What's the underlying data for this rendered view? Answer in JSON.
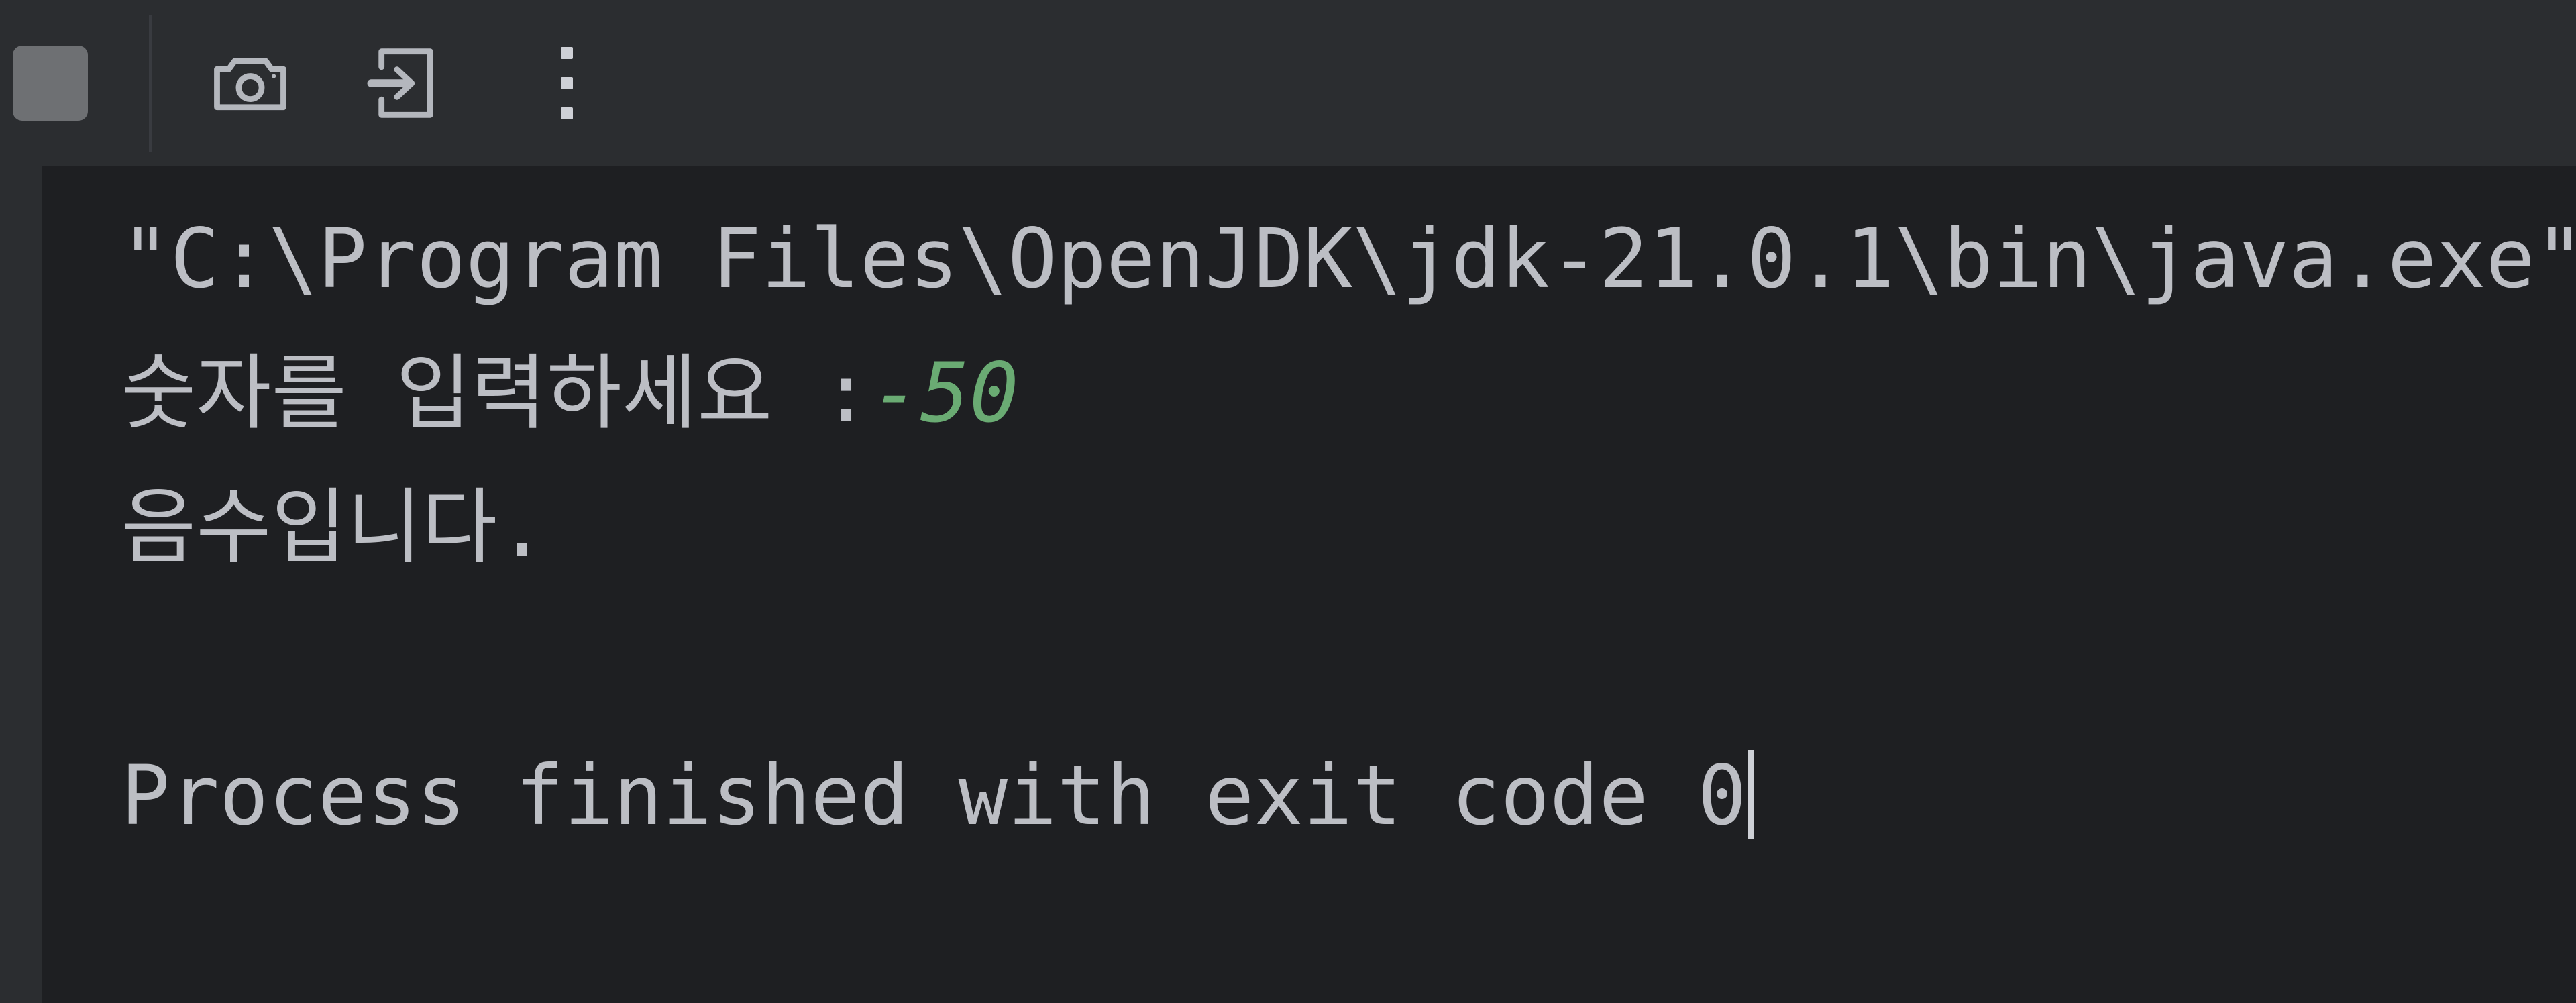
{
  "toolbar": {
    "buttons": [
      {
        "name": "stop-button",
        "icon": "stop-icon",
        "label": "Stop"
      },
      {
        "name": "screenshot-button",
        "icon": "camera-icon",
        "label": "Screenshot"
      },
      {
        "name": "soft-wrap-button",
        "icon": "arrow-into-box-icon",
        "label": "Soft-Wrap"
      },
      {
        "name": "more-options-button",
        "icon": "vertical-dots-icon",
        "label": "More Options"
      }
    ]
  },
  "console": {
    "lines": [
      {
        "id": "cmd",
        "text": "\"C:\\Program Files\\OpenJDK\\jdk-21.0.1\\bin\\java.exe\""
      },
      {
        "id": "prompt",
        "prompt": "숫자를 입력하세요 :",
        "input": "-50"
      },
      {
        "id": "result",
        "text": "음수입니다."
      },
      {
        "id": "blank",
        "text": " "
      },
      {
        "id": "exit",
        "text": "Process finished with exit code 0"
      }
    ],
    "exit_code": "0",
    "colors": {
      "background": "#1e1f22",
      "gutter": "#2b2d30",
      "toolbar": "#2b2d30",
      "text": "#bcbec4",
      "user_input": "#6aab73",
      "caret": "#ced0d6"
    }
  }
}
